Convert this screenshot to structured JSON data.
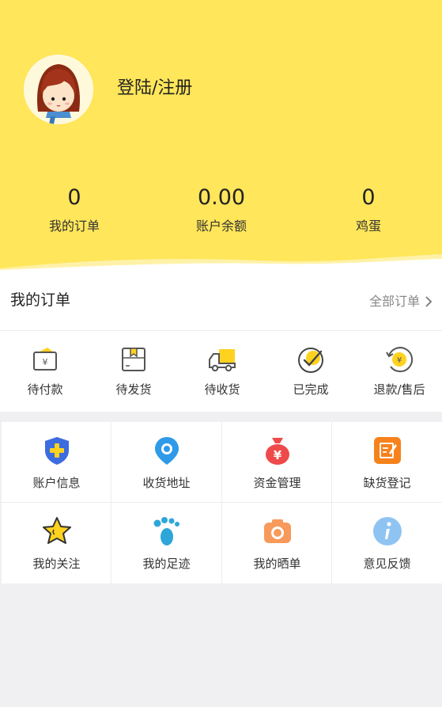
{
  "profile": {
    "login_label": "登陆/注册",
    "stats": [
      {
        "value": "0",
        "label": "我的订单"
      },
      {
        "value": "0.00",
        "label": "账户余额"
      },
      {
        "value": "0",
        "label": "鸡蛋"
      }
    ]
  },
  "orders": {
    "title": "我的订单",
    "all_label": "全部订单",
    "items": [
      {
        "label": "待付款",
        "icon": "wallet-icon"
      },
      {
        "label": "待发货",
        "icon": "package-icon"
      },
      {
        "label": "待收货",
        "icon": "truck-icon"
      },
      {
        "label": "已完成",
        "icon": "check-circle-icon"
      },
      {
        "label": "退款/售后",
        "icon": "refund-icon"
      }
    ]
  },
  "services": {
    "items": [
      {
        "label": "账户信息",
        "icon": "shield-plus-icon"
      },
      {
        "label": "收货地址",
        "icon": "location-pin-icon"
      },
      {
        "label": "资金管理",
        "icon": "money-bag-icon"
      },
      {
        "label": "缺货登记",
        "icon": "edit-note-icon"
      },
      {
        "label": "我的关注",
        "icon": "star-icon"
      },
      {
        "label": "我的足迹",
        "icon": "footprint-icon"
      },
      {
        "label": "我的晒单",
        "icon": "camera-icon"
      },
      {
        "label": "意见反馈",
        "icon": "info-icon"
      }
    ]
  },
  "colors": {
    "header_bg": "#ffe65a",
    "accent_yellow": "#ffd21f",
    "page_bg": "#f0f0f3"
  }
}
